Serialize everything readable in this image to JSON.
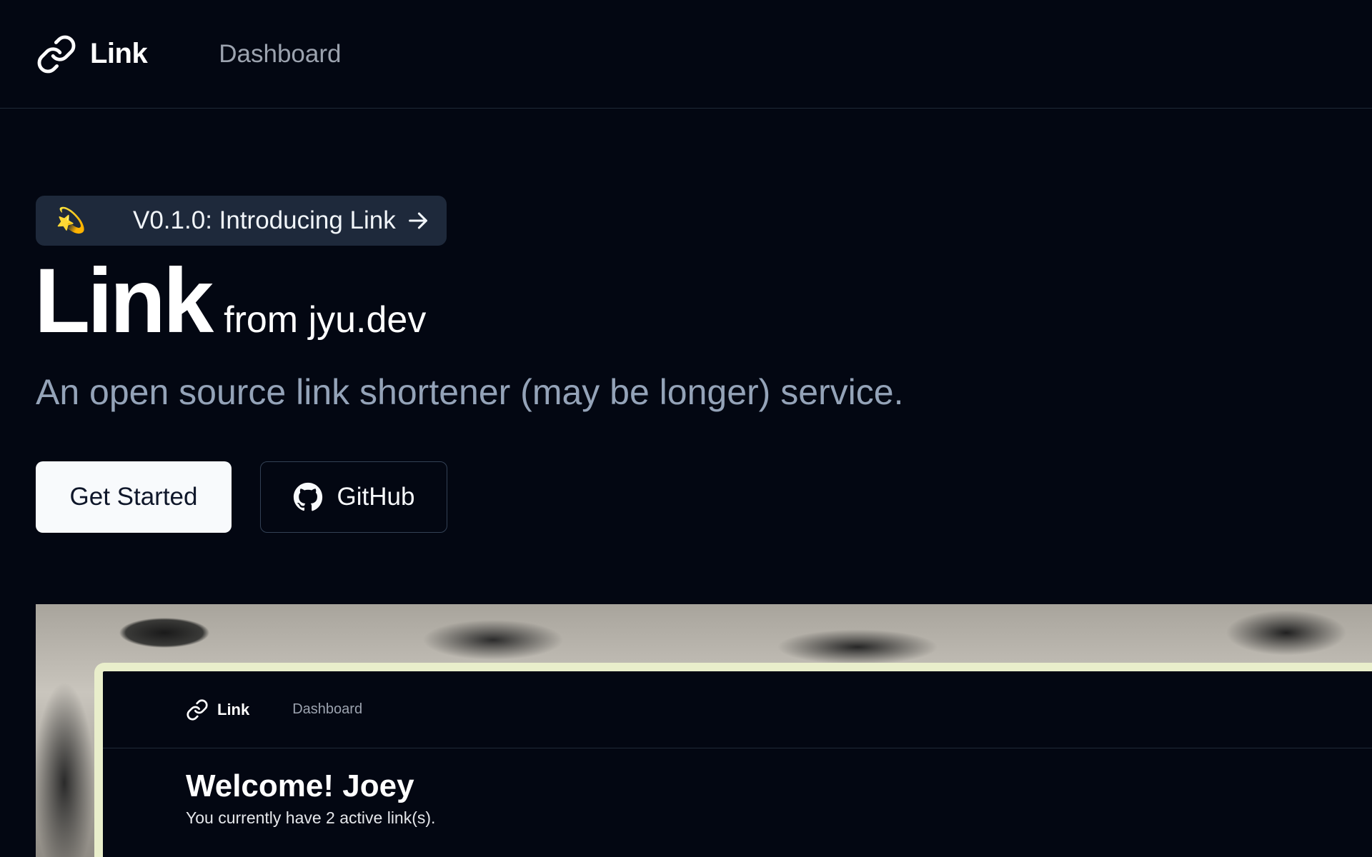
{
  "nav": {
    "brand": "Link",
    "brand_icon": "link-icon",
    "dashboard_label": "Dashboard"
  },
  "hero": {
    "announcement": {
      "emoji": "💫",
      "label": "V0.1.0: Introducing Link",
      "icon": "arrow-right-icon"
    },
    "title": "Link",
    "subtitle": "from jyu.dev",
    "tagline": "An open source link shortener (may be longer) service.",
    "primary_button": "Get Started",
    "secondary_button": "GitHub",
    "secondary_icon": "github-icon"
  },
  "preview": {
    "nav_brand": "Link",
    "nav_dashboard": "Dashboard",
    "welcome": "Welcome! Joey",
    "active_links": "You currently have 2 active link(s).",
    "frame_color": "#e9eecb"
  },
  "colors": {
    "background": "#030712",
    "muted_text": "#94a3b8",
    "badge_bg": "#1e293b"
  }
}
